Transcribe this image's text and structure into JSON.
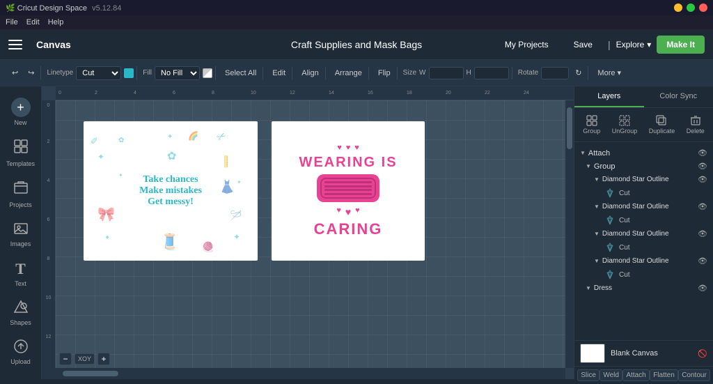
{
  "titlebar": {
    "app_name": "Cricut Design Space",
    "version": "v5.12.84",
    "win_min": "−",
    "win_max": "□",
    "win_close": "✕"
  },
  "menubar": {
    "items": [
      "File",
      "Edit",
      "Help"
    ]
  },
  "topnav": {
    "canvas_label": "Canvas",
    "project_title": "Craft Supplies and Mask Bags",
    "my_projects": "My Projects",
    "save": "Save",
    "explore": "Explore",
    "make_it": "Make It"
  },
  "toolbar": {
    "undo": "↩",
    "redo": "↪",
    "linetype_label": "Linetype",
    "fill_label": "Fill",
    "no_fill": "No Fill",
    "select_all": "Select All",
    "edit": "Edit",
    "align": "Align",
    "arrange": "Arrange",
    "flip": "Flip",
    "size": "Size",
    "w_label": "W",
    "h_label": "H",
    "rotate": "Rotate",
    "more": "More ▾"
  },
  "sidebar": {
    "items": [
      {
        "label": "New",
        "icon": "+"
      },
      {
        "label": "Templates",
        "icon": "📋"
      },
      {
        "label": "Projects",
        "icon": "📁"
      },
      {
        "label": "Images",
        "icon": "🖼"
      },
      {
        "label": "Text",
        "icon": "T"
      },
      {
        "label": "Shapes",
        "icon": "⬡"
      },
      {
        "label": "Upload",
        "icon": "⬆"
      }
    ]
  },
  "ruler": {
    "h_marks": [
      "0",
      "2",
      "4",
      "6",
      "8",
      "10",
      "12",
      "14",
      "16",
      "18",
      "20",
      "22",
      "24"
    ],
    "v_marks": [
      "0",
      "2",
      "4",
      "6",
      "8",
      "10",
      "12"
    ]
  },
  "card1": {
    "text_line1": "Take chances",
    "text_line2": "Make mistakes",
    "text_line3": "Get messy!"
  },
  "card2": {
    "text_line1": "WEARING IS",
    "text_line2": "",
    "text_line3": "CARING"
  },
  "rightpanel": {
    "tab_layers": "Layers",
    "tab_color_sync": "Color Sync",
    "actions": {
      "group": "Group",
      "ungroup": "UnGroup",
      "duplicate": "Duplicate",
      "delete": "Delete"
    },
    "layers": [
      {
        "type": "section",
        "name": "Attach",
        "visible": true,
        "children": [
          {
            "type": "group",
            "name": "Group",
            "visible": true,
            "children": [
              {
                "type": "sub",
                "name": "Diamond Star Outline",
                "visible": true,
                "cut_label": "Cut"
              },
              {
                "type": "sub",
                "name": "Diamond Star Outline",
                "visible": true,
                "cut_label": "Cut"
              },
              {
                "type": "sub",
                "name": "Diamond Star Outline",
                "visible": true,
                "cut_label": "Cut"
              },
              {
                "type": "sub",
                "name": "Diamond Star Outline",
                "visible": true,
                "cut_label": "Cut"
              }
            ]
          },
          {
            "type": "sub",
            "name": "Dress",
            "visible": true
          }
        ]
      }
    ],
    "blank_canvas_label": "Blank Canvas"
  },
  "bottom_actions": [
    "Slice",
    "Weld",
    "Attach",
    "Flatten",
    "Contour"
  ],
  "zoom": {
    "minus": "−",
    "plus": "+",
    "level": "XOY"
  }
}
